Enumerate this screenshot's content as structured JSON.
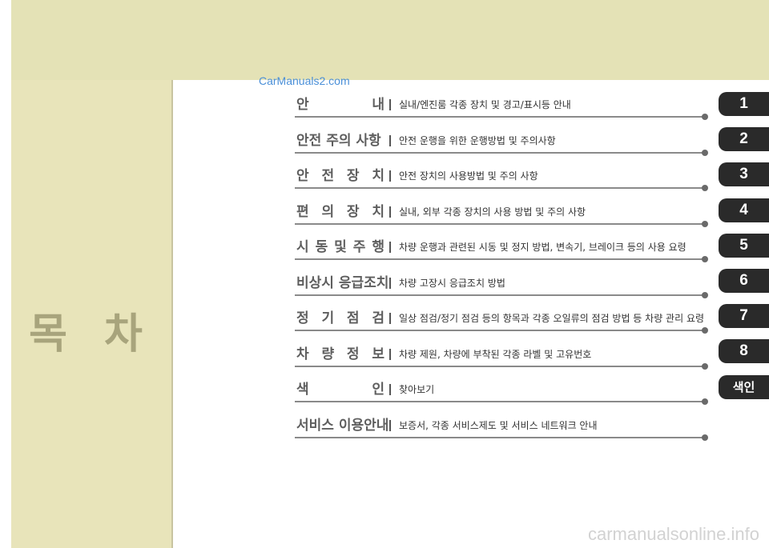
{
  "left_title": "목 차",
  "watermark": "CarManuals2.com",
  "footer_watermark": "carmanualsonline.info",
  "toc": [
    {
      "title": "안 내",
      "spread": true,
      "desc": "실내/엔진룸 각종 장치 및 경고/표시등 안내"
    },
    {
      "title": "안전 주의 사항",
      "spread": false,
      "desc": "안전 운행을 위한 운행방법 및 주의사항"
    },
    {
      "title": "안 전 장 치",
      "spread": true,
      "desc": "안전 장치의 사용방법 및 주의 사항"
    },
    {
      "title": "편 의 장 치",
      "spread": true,
      "desc": "실내, 외부 각종 장치의 사용 방법 및 주의 사항"
    },
    {
      "title": "시 동 및 주 행",
      "spread": true,
      "desc": "차량 운행과 관련된 시동 및 정지 방법, 변속기, 브레이크 등의 사용 요령"
    },
    {
      "title": "비상시 응급조치",
      "spread": false,
      "desc": "차량 고장시 응급조치 방법"
    },
    {
      "title": "정 기 점 검",
      "spread": true,
      "desc": "일상 점검/정기 점검 등의 항목과 각종 오일류의 점검 방법 등 차량 관리 요령"
    },
    {
      "title": "차 량 정 보",
      "spread": true,
      "desc": "차량 제원, 차량에 부착된 각종 라벨 및 고유번호"
    },
    {
      "title": "색 인",
      "spread": true,
      "desc": "찾아보기"
    },
    {
      "title": "서비스 이용안내",
      "spread": false,
      "desc": "보증서, 각종 서비스제도 및 서비스 네트워크 안내"
    }
  ],
  "tabs": [
    "1",
    "2",
    "3",
    "4",
    "5",
    "6",
    "7",
    "8",
    "색인"
  ]
}
